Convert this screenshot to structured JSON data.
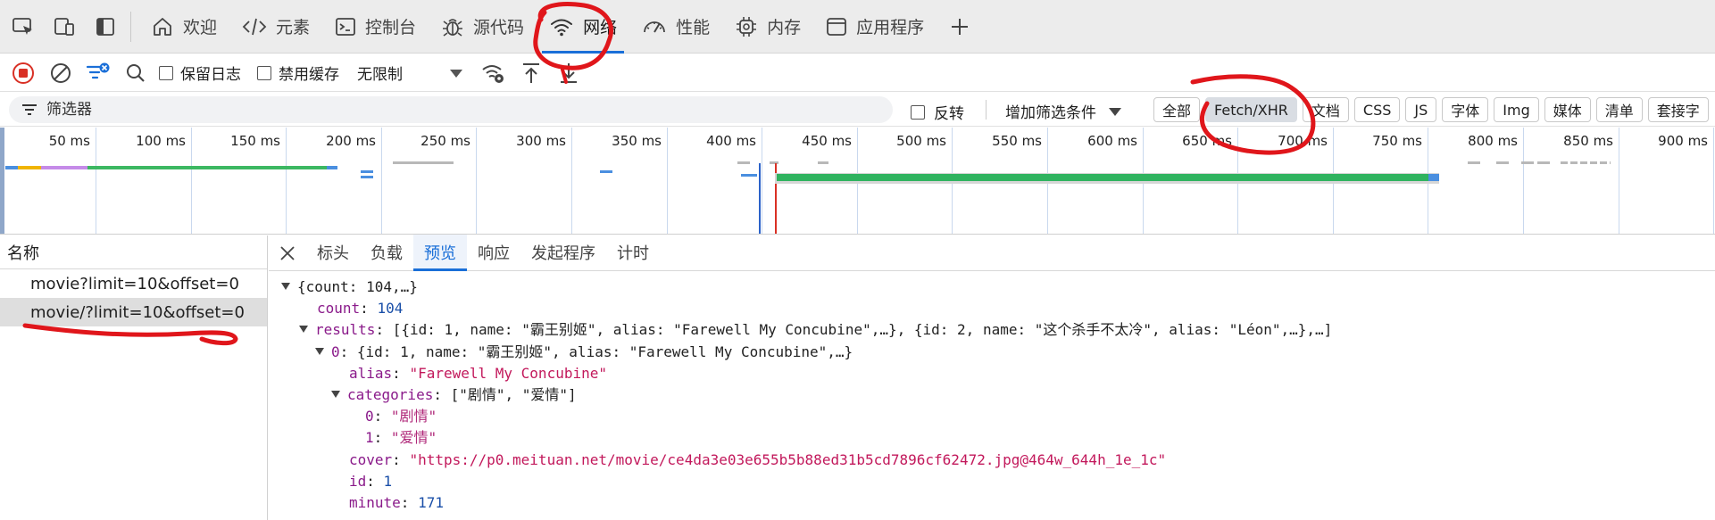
{
  "tabs": [
    {
      "id": "welcome",
      "label": "欢迎",
      "icon": "home-icon"
    },
    {
      "id": "elements",
      "label": "元素",
      "icon": "code-icon"
    },
    {
      "id": "console",
      "label": "控制台",
      "icon": "terminal-icon"
    },
    {
      "id": "sources",
      "label": "源代码",
      "icon": "bug-icon"
    },
    {
      "id": "network",
      "label": "网络",
      "icon": "wifi-icon",
      "active": true
    },
    {
      "id": "performance",
      "label": "性能",
      "icon": "performance-icon"
    },
    {
      "id": "memory",
      "label": "内存",
      "icon": "chip-icon"
    },
    {
      "id": "application",
      "label": "应用程序",
      "icon": "window-icon"
    }
  ],
  "toolbar": {
    "preserve_log": "保留日志",
    "disable_cache": "禁用缓存",
    "throttling": "无限制"
  },
  "filter": {
    "placeholder": "筛选器",
    "invert": "反转",
    "add_filter": "增加筛选条件",
    "types": [
      "全部",
      "Fetch/XHR",
      "文档",
      "CSS",
      "JS",
      "字体",
      "Img",
      "媒体",
      "清单",
      "套接字"
    ],
    "active_type": "Fetch/XHR"
  },
  "overview": {
    "ticks": [
      "50 ms",
      "100 ms",
      "150 ms",
      "200 ms",
      "250 ms",
      "300 ms",
      "350 ms",
      "400 ms",
      "450 ms",
      "500 ms",
      "550 ms",
      "600 ms",
      "650 ms",
      "700 ms",
      "750 ms",
      "800 ms",
      "850 ms",
      "900 ms"
    ]
  },
  "requests": {
    "header": "名称",
    "items": [
      {
        "name": "movie?limit=10&offset=0",
        "selected": false
      },
      {
        "name": "movie/?limit=10&offset=0",
        "selected": true
      }
    ]
  },
  "detail_tabs": [
    {
      "label": "标头"
    },
    {
      "label": "负载"
    },
    {
      "label": "预览",
      "active": true
    },
    {
      "label": "响应"
    },
    {
      "label": "发起程序"
    },
    {
      "label": "计时"
    }
  ],
  "preview": {
    "root": "{count: 104,…}",
    "count_key": "count",
    "count_val": "104",
    "results_key": "results",
    "results_summary": "[{id: 1, name: \"霸王别姬\", alias: \"Farewell My Concubine\",…}, {id: 2, name: \"这个杀手不太冷\", alias: \"Léon\",…},…]",
    "item0_key": "0",
    "item0_summary": "{id: 1, name: \"霸王别姬\", alias: \"Farewell My Concubine\",…}",
    "alias_key": "alias",
    "alias_val": "\"Farewell My Concubine\"",
    "categories_key": "categories",
    "categories_summary": "[\"剧情\", \"爱情\"]",
    "cat0_key": "0",
    "cat0_val": "\"剧情\"",
    "cat1_key": "1",
    "cat1_val": "\"爱情\"",
    "cover_key": "cover",
    "cover_val": "\"https://p0.meituan.net/movie/ce4da3e03e655b5b88ed31b5cd7896cf62472.jpg@464w_644h_1e_1c\"",
    "id_key": "id",
    "id_val": "1",
    "minute_key": "minute",
    "minute_val": "171"
  },
  "colors": {
    "accent": "#1a6fd8",
    "annotation": "#e0161b"
  }
}
